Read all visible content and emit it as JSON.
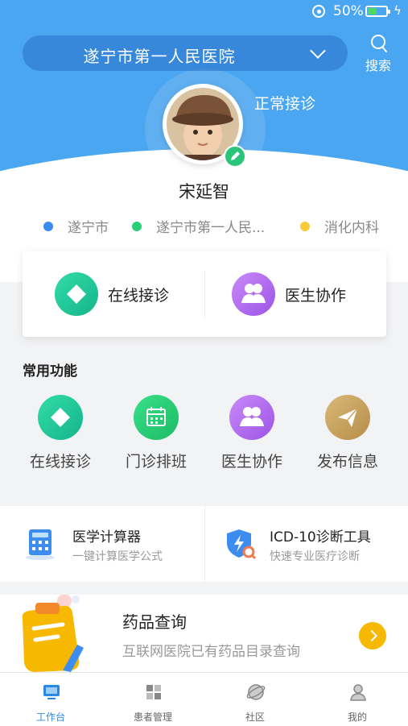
{
  "status_bar": {
    "battery": "50%",
    "battery_level": 0.5
  },
  "header": {
    "hospital": "遂宁市第一人民医院",
    "search_label": "搜索",
    "status": "正常接诊"
  },
  "doctor": {
    "name": "宋延智",
    "tags": [
      {
        "text": "遂宁市",
        "color": "#3b8cf2"
      },
      {
        "text": "遂宁市第一人民...",
        "color": "#2bcf7a"
      },
      {
        "text": "消化内科",
        "color": "#f6cc3d"
      }
    ]
  },
  "main_actions": [
    {
      "label": "在线接诊",
      "icon": "clinic-icon",
      "color": "#20c898"
    },
    {
      "label": "医生协作",
      "icon": "doctors-icon",
      "color": "#b06ef0"
    }
  ],
  "common": {
    "title": "常用功能",
    "items": [
      {
        "label": "在线接诊",
        "icon": "clinic-icon",
        "color": "#20c898"
      },
      {
        "label": "门诊排班",
        "icon": "calendar-icon",
        "color": "#2bcf7a"
      },
      {
        "label": "医生协作",
        "icon": "doctors-icon",
        "color": "#b06ef0"
      },
      {
        "label": "发布信息",
        "icon": "paper-plane-icon",
        "color": "#c9a45e"
      }
    ]
  },
  "tools": [
    {
      "title": "医学计算器",
      "subtitle": "一键计算医学公式",
      "icon": "calculator-icon"
    },
    {
      "title": "ICD-10诊断工具",
      "subtitle": "快速专业医疗诊断",
      "icon": "shield-bolt-icon"
    }
  ],
  "drug": {
    "title": "药品查询",
    "subtitle": "互联网医院已有药品目录查询",
    "icon": "clipboard-pen-icon"
  },
  "tabs": [
    {
      "label": "工作台",
      "icon": "desktop-icon",
      "active": true
    },
    {
      "label": "患者管理",
      "icon": "grid-icon",
      "active": false
    },
    {
      "label": "社区",
      "icon": "planet-icon",
      "active": false
    },
    {
      "label": "我的",
      "icon": "person-icon",
      "active": false
    }
  ]
}
